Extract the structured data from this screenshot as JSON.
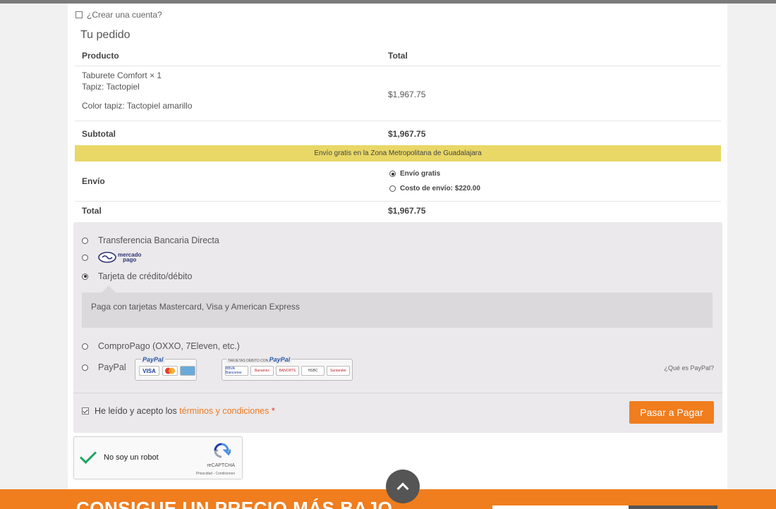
{
  "create_account": {
    "label": "¿Crear una cuenta?"
  },
  "order": {
    "title": "Tu pedido",
    "headers": {
      "product": "Producto",
      "total": "Total"
    },
    "item": {
      "name": "Taburete Comfort",
      "quantity": "× 1",
      "tapiz": "Tapiz: Tactopiel",
      "color_tapiz": "Color tapiz: Tactopiel amarillo",
      "total": "$1,967.75"
    },
    "subtotal_label": "Subtotal",
    "subtotal_value": "$1,967.75",
    "free_shipping_banner": "Envío gratis en la Zona Metropolitana de Guadalajara",
    "shipping_label": "Envío",
    "shipping_options": [
      {
        "label": "Envío gratis",
        "selected": true
      },
      {
        "label": "Costo de envío: $220.00",
        "selected": false
      }
    ],
    "total_label": "Total",
    "total_value": "$1,967.75"
  },
  "payment": {
    "methods": [
      {
        "label": "Transferencia Bancaria Directa",
        "selected": false
      },
      {
        "label": "",
        "logo": "mercado-pago-logo",
        "logo_text_1": "mercado",
        "logo_text_2": "pago",
        "selected": false
      },
      {
        "label": "Tarjeta de crédito/débito",
        "selected": true
      },
      {
        "label": "ComproPago (OXXO, 7Eleven, etc.)",
        "selected": false
      },
      {
        "label": "PayPal",
        "selected": false
      }
    ],
    "card_description": "Paga con tarjetas Mastercard, Visa y American Express",
    "paypal_logo": "PayPal",
    "paypal_debit_title": "TARJETAS DÉBITO CON",
    "paypal_cards": [
      "VISA",
      "MC",
      "AMEX"
    ],
    "paypal_banks": [
      "BBVA Bancomer",
      "Banamex",
      "BANORTE",
      "HSBC",
      "Santander"
    ],
    "paypal_link": "¿Qué es PayPal?",
    "terms_prefix": "He leído y acepto los ",
    "terms_link": "términos y condiciones",
    "terms_required": "*",
    "terms_checked": true,
    "submit_label": "Pasar a Pagar"
  },
  "captcha": {
    "label": "No soy un robot",
    "brand": "reCAPTCHA",
    "links": "Privacidad - Condiciones",
    "checked": true
  },
  "footer": {
    "title": "CONSIGUE UN PRECIO MÁS BAJO"
  },
  "colors": {
    "accent": "#f07d1e",
    "banner": "#e9d766",
    "captcha_check": "#1ea362"
  }
}
